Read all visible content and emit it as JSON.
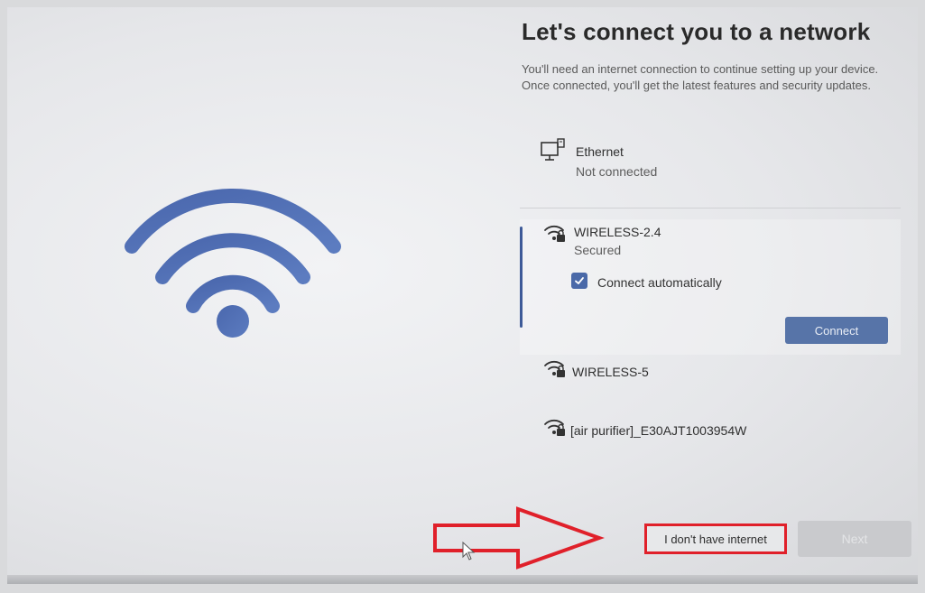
{
  "page": {
    "title": "Let's connect you to a network",
    "description": "You'll need an internet connection to continue setting up your device. Once connected, you'll get the latest features and security updates."
  },
  "ethernet": {
    "icon": "ethernet-icon",
    "name": "Ethernet",
    "status": "Not connected"
  },
  "networks": [
    {
      "icon": "wifi-secured-icon",
      "name": "WIRELESS-2.4",
      "status": "Secured",
      "selected": true,
      "connect_automatically_label": "Connect automatically",
      "connect_automatically_checked": true,
      "connect_button_label": "Connect"
    },
    {
      "icon": "wifi-secured-icon",
      "name": "WIRELESS-5"
    },
    {
      "icon": "wifi-secured-icon",
      "name": "[air purifier]_E30AJT1003954W"
    }
  ],
  "footer": {
    "no_internet_label": "I don't have internet",
    "next_label": "Next",
    "next_enabled": false
  },
  "annotation": {
    "arrow_color": "#e0202a",
    "highlight_color": "#e0202a"
  },
  "colors": {
    "accent": "#3d5a98",
    "wifi_art": "#4f6fb0"
  }
}
